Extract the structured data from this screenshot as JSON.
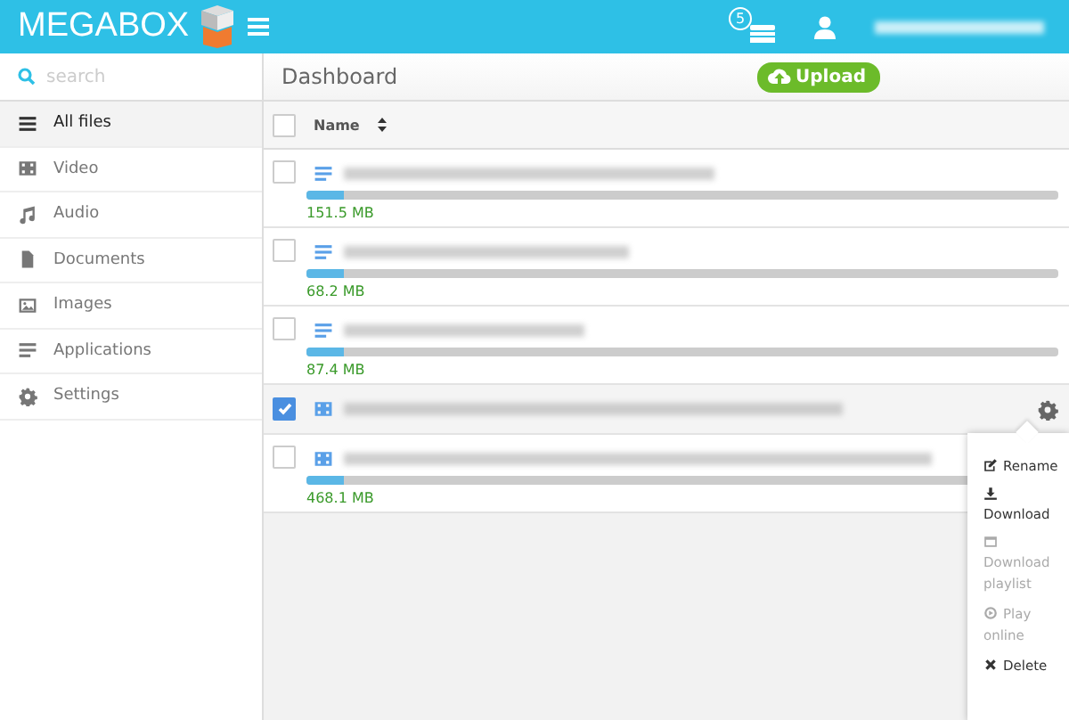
{
  "header": {
    "logo": "MEGABOX",
    "notification_count": "5"
  },
  "search": {
    "placeholder": "search"
  },
  "page_title": "Dashboard",
  "upload_button": "Upload",
  "sidebar": {
    "items": [
      {
        "kind": "list",
        "label": "All files",
        "selected": true
      },
      {
        "kind": "video",
        "label": "Video",
        "selected": false
      },
      {
        "kind": "audio",
        "label": "Audio",
        "selected": false
      },
      {
        "kind": "document",
        "label": "Documents",
        "selected": false
      },
      {
        "kind": "image",
        "label": "Images",
        "selected": false
      },
      {
        "kind": "application",
        "label": "Applications",
        "selected": false
      },
      {
        "kind": "settings",
        "label": "Settings",
        "selected": false
      }
    ]
  },
  "table": {
    "columns": [
      {
        "label": "Name"
      }
    ],
    "select_all": {
      "checked": false
    },
    "rows": [
      {
        "kind": "archive",
        "checked": false,
        "selected": false,
        "level": 0.05,
        "size": "151.5 MB"
      },
      {
        "kind": "archive",
        "checked": false,
        "selected": false,
        "level": 0.05,
        "size": "68.2 MB"
      },
      {
        "kind": "archive",
        "checked": false,
        "selected": false,
        "level": 0.05,
        "size": "87.4 MB"
      },
      {
        "kind": "video",
        "checked": true,
        "selected": true
      },
      {
        "kind": "video",
        "checked": false,
        "selected": false,
        "level": 0.05,
        "size": "468.1 MB"
      }
    ]
  },
  "menu": {
    "items": [
      {
        "kind": "rename",
        "label": "Rename",
        "disabled": false
      },
      {
        "kind": "download",
        "label": "Download",
        "disabled": false
      },
      {
        "kind": "playlist",
        "label": "Download playlist",
        "disabled": true
      },
      {
        "kind": "play",
        "label": "Play online",
        "disabled": true
      },
      {
        "kind": "delete",
        "label": "Delete",
        "disabled": false
      }
    ]
  }
}
